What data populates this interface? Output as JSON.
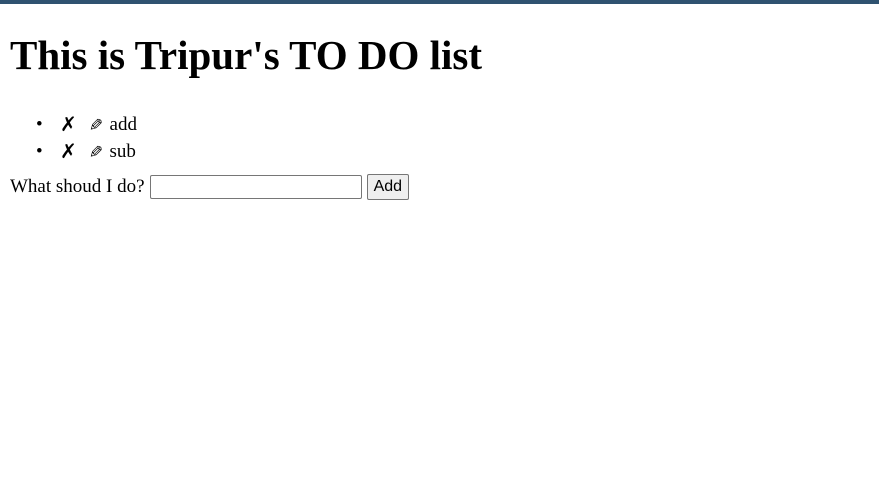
{
  "header": {
    "title": "This is Tripur's TO DO list"
  },
  "todos": [
    {
      "delete_symbol": "✗",
      "edit_symbol": "✎",
      "text": "add"
    },
    {
      "delete_symbol": "✗",
      "edit_symbol": "✎",
      "text": "sub"
    }
  ],
  "form": {
    "label": "What shoud I do?",
    "input_value": "",
    "button_label": "Add"
  },
  "colors": {
    "top_bar": "#2f5270"
  }
}
